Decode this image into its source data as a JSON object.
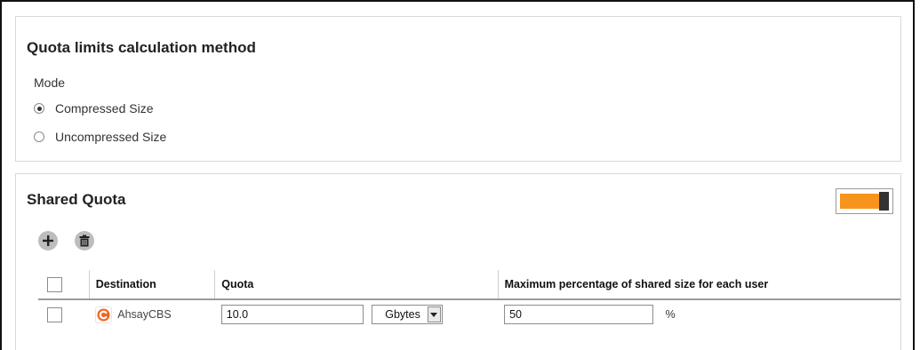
{
  "quota_method": {
    "title": "Quota limits calculation method",
    "mode_label": "Mode",
    "options": [
      {
        "label": "Compressed Size",
        "selected": true
      },
      {
        "label": "Uncompressed Size",
        "selected": false
      }
    ]
  },
  "shared_quota": {
    "title": "Shared Quota",
    "toggle_on": true,
    "toggle_color": "#f7941d",
    "toolbar": {
      "add_icon": "plus-icon",
      "delete_icon": "trash-icon"
    },
    "table": {
      "headers": {
        "destination": "Destination",
        "quota": "Quota",
        "max_pct": "Maximum percentage of shared size for each user"
      },
      "rows": [
        {
          "destination": "AhsayCBS",
          "destination_icon": "ahsay-logo-icon",
          "quota_value": "10.0",
          "unit": "Gbytes",
          "max_pct": "50",
          "pct_sign": "%"
        }
      ]
    }
  }
}
